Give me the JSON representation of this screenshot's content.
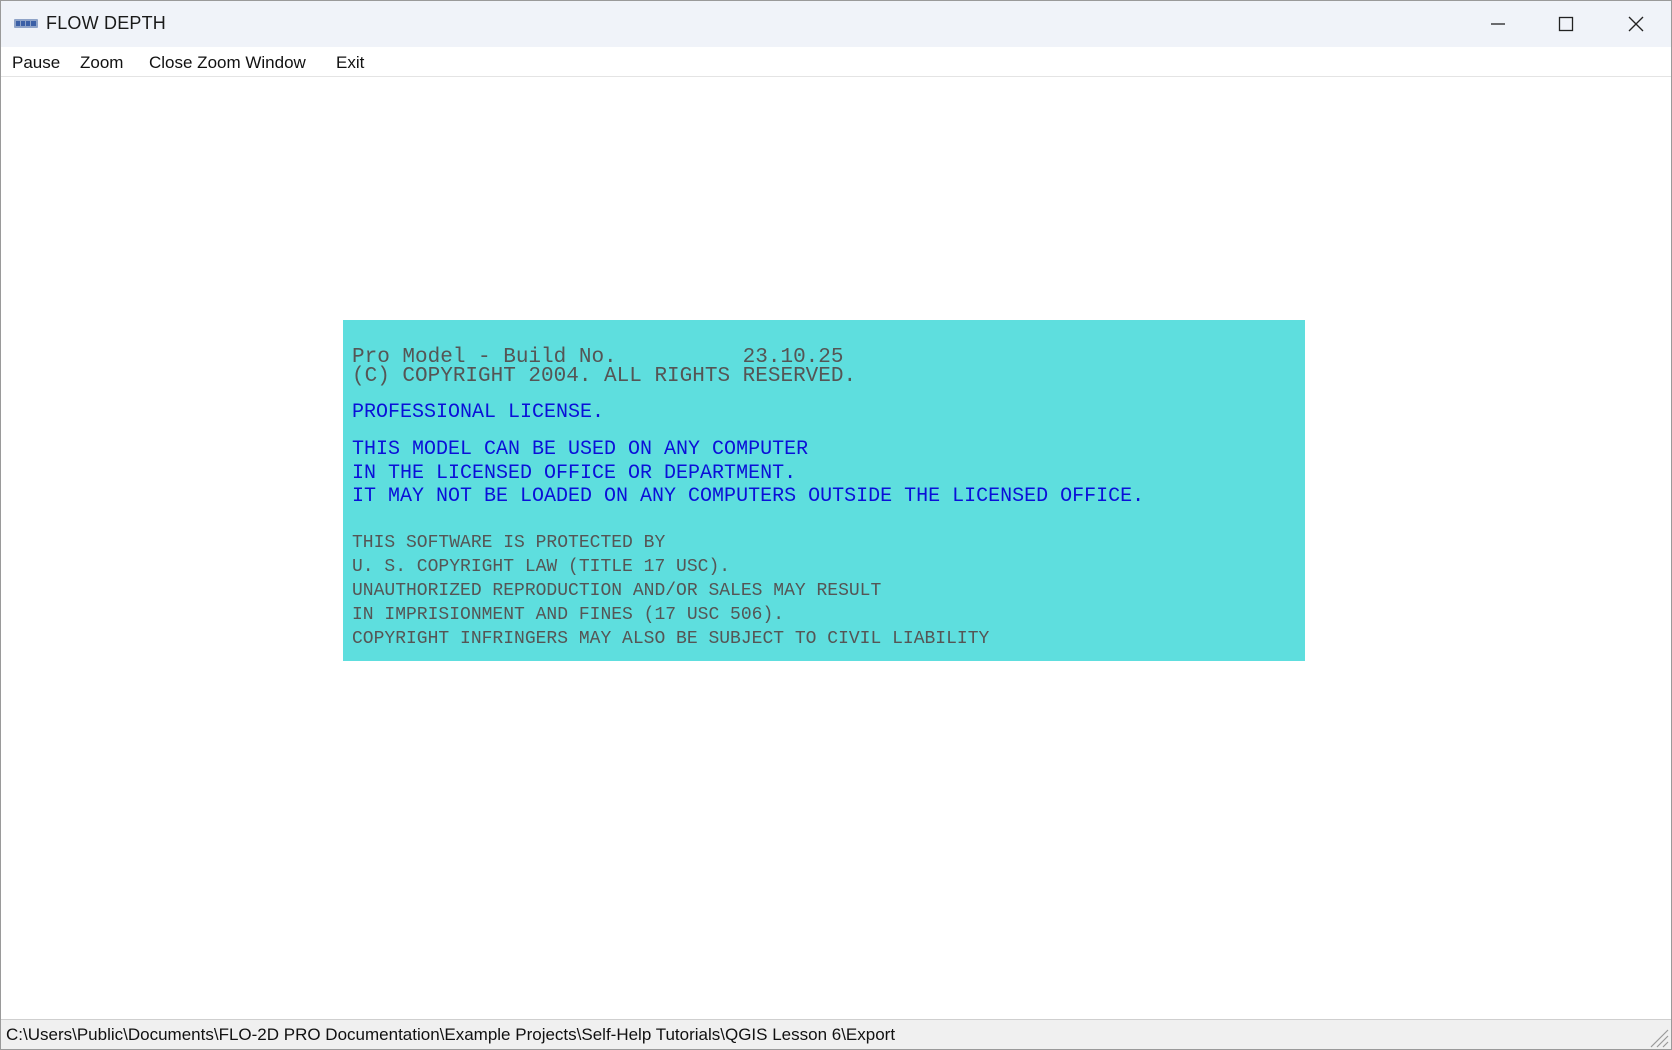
{
  "window": {
    "title": "FLOW DEPTH"
  },
  "icons": {
    "app": "flo2d-app-icon",
    "minimize": "minimize-icon",
    "maximize": "maximize-icon",
    "close": "close-icon",
    "grip": "resize-grip-icon"
  },
  "menu": {
    "items": [
      "Pause",
      "Zoom",
      "Close Zoom Window",
      "Exit"
    ]
  },
  "license": {
    "build_line": "Pro Model - Build No.          23.10.25",
    "copyright_line": "(C) COPYRIGHT 2004. ALL RIGHTS RESERVED.",
    "license_type": "PROFESSIONAL LICENSE.",
    "terms": [
      "THIS MODEL CAN BE USED ON ANY COMPUTER",
      "IN THE LICENSED OFFICE OR DEPARTMENT.",
      "IT MAY NOT BE LOADED ON ANY COMPUTERS OUTSIDE THE LICENSED OFFICE."
    ],
    "legal": [
      "THIS SOFTWARE IS PROTECTED BY",
      "U. S. COPYRIGHT LAW (TITLE 17 USC).",
      "UNAUTHORIZED REPRODUCTION AND/OR SALES MAY RESULT",
      "IN IMPRISIONMENT AND FINES (17 USC 506).",
      "COPYRIGHT INFRINGERS MAY ALSO BE SUBJECT TO CIVIL LIABILITY"
    ]
  },
  "status": {
    "path": "C:\\Users\\Public\\Documents\\FLO-2D PRO Documentation\\Example Projects\\Self-Help Tutorials\\QGIS Lesson 6\\Export"
  },
  "colors": {
    "panel_background": "#5edede",
    "license_text": "#0a10d8",
    "notice_text": "#555555",
    "titlebar": "#f0f3f9"
  }
}
